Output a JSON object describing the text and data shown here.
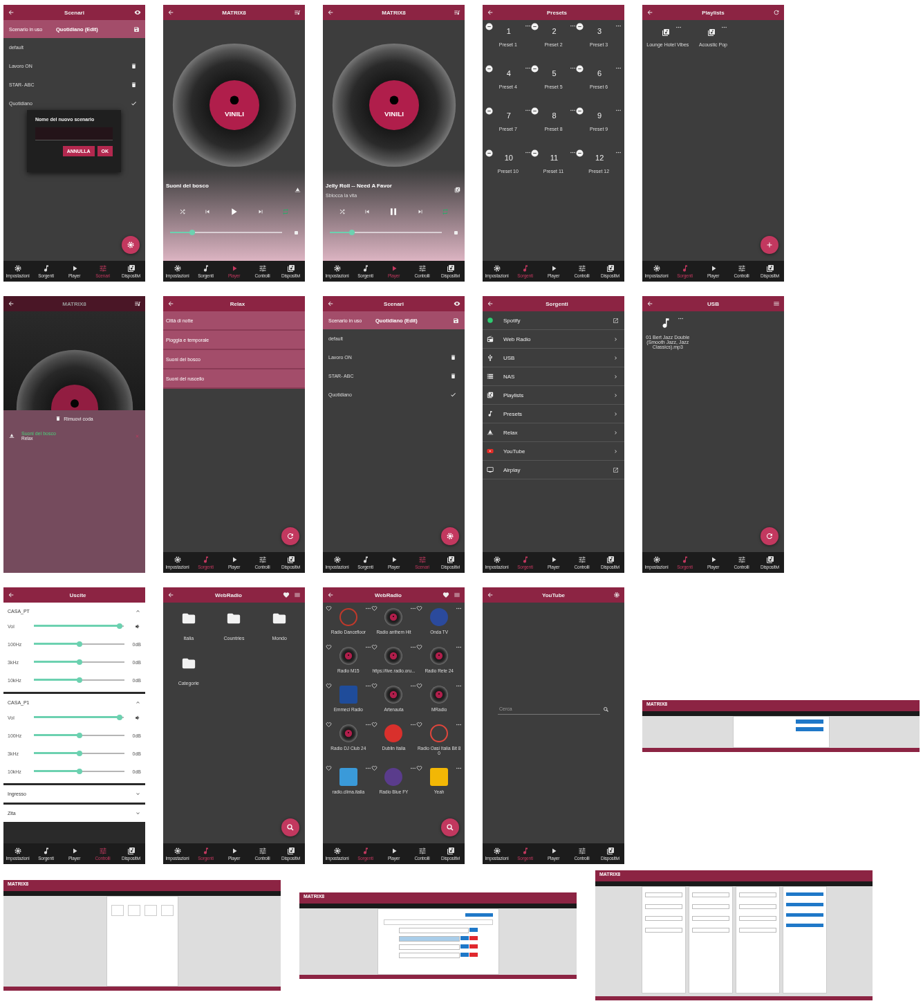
{
  "rows": [
    {
      "screens": [
        {
          "kind": "scenari",
          "title": "Scenari",
          "current": {
            "label": "Scenario in uso",
            "value": "Quotidiano (Edit)"
          },
          "items": [
            {
              "label": "default",
              "selected": false,
              "deletable": false
            },
            {
              "label": "Lavoro ON",
              "selected": false,
              "deletable": true
            },
            {
              "label": "STAR- ABC",
              "selected": false,
              "deletable": true
            },
            {
              "label": "Quotidiano",
              "selected": true,
              "deletable": false
            }
          ],
          "dialog": {
            "title": "Nome del nuovo scenario",
            "buttons": [
              "ANNULLA",
              "OK"
            ]
          },
          "nav": [
            {
              "label": "Impostazioni",
              "selected": false
            },
            {
              "label": "Sorgenti",
              "selected": false
            },
            {
              "label": "Player",
              "selected": false
            },
            {
              "label": "Scenari",
              "selected": true
            },
            {
              "label": "Dispositivi",
              "selected": false
            }
          ]
        },
        {
          "kind": "player",
          "title": "MATRIX8",
          "disc_label": "VINILI",
          "track": "Suoni del bosco",
          "playing": false,
          "level": 0.22,
          "nav": [
            {
              "label": "Impostazioni",
              "selected": false
            },
            {
              "label": "Sorgenti",
              "selected": false
            },
            {
              "label": "Player",
              "selected": true
            },
            {
              "label": "Controlli",
              "selected": false
            },
            {
              "label": "Dispositivi",
              "selected": false
            }
          ]
        },
        {
          "kind": "player",
          "title": "MATRIX8",
          "disc_label": "VINILI",
          "track": "Jelly Roll -- Need A Favor",
          "subtitle": "Sblocca la vita",
          "playing": true,
          "level": 0.22,
          "nav": [
            {
              "label": "Impostazioni",
              "selected": false
            },
            {
              "label": "Sorgenti",
              "selected": false
            },
            {
              "label": "Player",
              "selected": true
            },
            {
              "label": "Controlli",
              "selected": false
            },
            {
              "label": "Dispositivi",
              "selected": false
            }
          ]
        },
        {
          "kind": "presets",
          "title": "Presets",
          "items": [
            {
              "number": "1",
              "label": "Preset 1"
            },
            {
              "number": "2",
              "label": "Preset 2"
            },
            {
              "number": "3",
              "label": "Preset 3"
            },
            {
              "number": "4",
              "label": "Preset 4"
            },
            {
              "number": "5",
              "label": "Preset 5"
            },
            {
              "number": "6",
              "label": "Preset 6"
            },
            {
              "number": "7",
              "label": "Preset 7"
            },
            {
              "number": "8",
              "label": "Preset 8"
            },
            {
              "number": "9",
              "label": "Preset 9"
            },
            {
              "number": "10",
              "label": "Preset 10"
            },
            {
              "number": "11",
              "label": "Preset 11"
            },
            {
              "number": "12",
              "label": "Preset 12"
            }
          ],
          "nav": [
            {
              "label": "Impostazioni",
              "selected": false
            },
            {
              "label": "Sorgenti",
              "selected": true
            },
            {
              "label": "Player",
              "selected": false
            },
            {
              "label": "Controlli",
              "selected": false
            },
            {
              "label": "Dispositivi",
              "selected": false
            }
          ]
        },
        {
          "kind": "playlists",
          "title": "Playlists",
          "items": [
            {
              "label": "Lounge Hotel Vibes"
            },
            {
              "label": "Acoustic Pop"
            }
          ],
          "nav": [
            {
              "label": "Impostazioni",
              "selected": false
            },
            {
              "label": "Sorgenti",
              "selected": true
            },
            {
              "label": "Player",
              "selected": false
            },
            {
              "label": "Controlli",
              "selected": false
            },
            {
              "label": "Dispositivi",
              "selected": false
            }
          ]
        }
      ]
    },
    {
      "screens": [
        {
          "kind": "queue",
          "title": "MATRIX8",
          "clear_label": "Rimuovi coda",
          "items": [
            {
              "title": "Suoni del bosco",
              "subtitle": "Relax"
            }
          ]
        },
        {
          "kind": "list",
          "title": "Relax",
          "items": [
            {
              "label": "Città di notte"
            },
            {
              "label": "Pioggia e temporale"
            },
            {
              "label": "Suoni del bosco"
            },
            {
              "label": "Suoni del ruscello"
            }
          ],
          "nav": [
            {
              "label": "Impostazioni",
              "selected": false
            },
            {
              "label": "Sorgenti",
              "selected": true
            },
            {
              "label": "Player",
              "selected": false
            },
            {
              "label": "Controlli",
              "selected": false
            },
            {
              "label": "Dispositivi",
              "selected": false
            }
          ]
        },
        {
          "kind": "scenari",
          "title": "Scenari",
          "current": {
            "label": "Scenario in uso",
            "value": "Quotidiano (Edit)"
          },
          "items": [
            {
              "label": "default",
              "selected": false,
              "deletable": false
            },
            {
              "label": "Lavoro ON",
              "selected": false,
              "deletable": true
            },
            {
              "label": "STAR- ABC",
              "selected": false,
              "deletable": true
            },
            {
              "label": "Quotidiano",
              "selected": true,
              "deletable": false
            }
          ],
          "nav": [
            {
              "label": "Impostazioni",
              "selected": false
            },
            {
              "label": "Sorgenti",
              "selected": false
            },
            {
              "label": "Player",
              "selected": false
            },
            {
              "label": "Scenari",
              "selected": true
            },
            {
              "label": "Dispositivi",
              "selected": false
            }
          ]
        },
        {
          "kind": "sources",
          "title": "Sorgenti",
          "items": [
            {
              "label": "Spotify"
            },
            {
              "label": "Web Radio"
            },
            {
              "label": "USB"
            },
            {
              "label": "NAS"
            },
            {
              "label": "Playlists"
            },
            {
              "label": "Presets"
            },
            {
              "label": "Relax"
            },
            {
              "label": "YouTube"
            },
            {
              "label": "Airplay"
            }
          ],
          "nav": [
            {
              "label": "Impostazioni",
              "selected": false
            },
            {
              "label": "Sorgenti",
              "selected": true
            },
            {
              "label": "Player",
              "selected": false
            },
            {
              "label": "Controlli",
              "selected": false
            },
            {
              "label": "Dispositivi",
              "selected": false
            }
          ]
        },
        {
          "kind": "usb",
          "title": "USB",
          "items": [
            {
              "label": "01 Bert Jazz Double (Smooth Jazz, Jazz Classics).mp3"
            }
          ],
          "nav": [
            {
              "label": "Impostazioni",
              "selected": false
            },
            {
              "label": "Sorgenti",
              "selected": true
            },
            {
              "label": "Player",
              "selected": false
            },
            {
              "label": "Controlli",
              "selected": false
            },
            {
              "label": "Dispositivi",
              "selected": false
            }
          ]
        }
      ]
    },
    {
      "screens": [
        {
          "kind": "outputs",
          "title": "Uscite",
          "sections": [
            {
              "name": "CASA_PT",
              "expanded": true,
              "channels": [
                {
                  "kind": "volume",
                  "label": "Vol",
                  "level": 0.95
                },
                {
                  "kind": "eq",
                  "label": "100Hz",
                  "level": 0.5,
                  "reading": "0dB"
                },
                {
                  "kind": "eq",
                  "label": "3kHz",
                  "level": 0.5,
                  "reading": "0dB"
                },
                {
                  "kind": "eq",
                  "label": "10kHz",
                  "level": 0.5,
                  "reading": "0dB"
                }
              ]
            },
            {
              "name": "CASA_P1",
              "expanded": true,
              "channels": [
                {
                  "kind": "volume",
                  "label": "Vol",
                  "level": 0.95
                },
                {
                  "kind": "eq",
                  "label": "100Hz",
                  "level": 0.5,
                  "reading": "0dB"
                },
                {
                  "kind": "eq",
                  "label": "3kHz",
                  "level": 0.5,
                  "reading": "0dB"
                },
                {
                  "kind": "eq",
                  "label": "10kHz",
                  "level": 0.5,
                  "reading": "0dB"
                }
              ]
            },
            {
              "name": "Ingresso",
              "expanded": false
            },
            {
              "name": "Zita",
              "expanded": false
            }
          ],
          "nav": [
            {
              "label": "Impostazioni",
              "selected": false
            },
            {
              "label": "Sorgenti",
              "selected": false
            },
            {
              "label": "Player",
              "selected": false
            },
            {
              "label": "Controlli",
              "selected": true
            },
            {
              "label": "Dispositivi",
              "selected": false
            }
          ]
        },
        {
          "kind": "folders",
          "title": "WebRadio",
          "items": [
            {
              "label": "Italia"
            },
            {
              "label": "Countries"
            },
            {
              "label": "Mondo"
            },
            {
              "label": "Categorie"
            }
          ],
          "nav": [
            {
              "label": "Impostazioni",
              "selected": false
            },
            {
              "label": "Sorgenti",
              "selected": true
            },
            {
              "label": "Player",
              "selected": false
            },
            {
              "label": "Controlli",
              "selected": false
            },
            {
              "label": "Dispositivi",
              "selected": false
            }
          ]
        },
        {
          "kind": "stations",
          "title": "WebRadio",
          "items": [
            {
              "label": "Radio Dancefloor",
              "kind": "ring",
              "color": "#c0392b"
            },
            {
              "label": "Radio anthem Hit",
              "kind": "vinyl"
            },
            {
              "label": "Onda TV",
              "kind": "badge",
              "color": "#2b4a9c"
            },
            {
              "label": "Radio M15",
              "kind": "vinyl"
            },
            {
              "label": "https://live.radio.oru...",
              "kind": "vinyl"
            },
            {
              "label": "Radio Rete 24",
              "kind": "vinyl"
            },
            {
              "label": "Emmeci Radio",
              "kind": "square",
              "color": "#1f4c9a"
            },
            {
              "label": "Artenauta",
              "kind": "vinyl"
            },
            {
              "label": "MRadio",
              "kind": "vinyl"
            },
            {
              "label": "Radio DJ Club 24",
              "kind": "vinyl"
            },
            {
              "label": "Dublin Italia",
              "kind": "badge",
              "color": "#d9302c"
            },
            {
              "label": "Radio Oasi Italia Bit 80",
              "kind": "ring",
              "color": "#e0463c"
            },
            {
              "label": "radio.clima.italia",
              "kind": "square",
              "color": "#3a9ad9"
            },
            {
              "label": "Radio Blue FY",
              "kind": "badge",
              "color": "#5a3c8c"
            },
            {
              "label": "Yeah",
              "kind": "square",
              "color": "#f2b705"
            }
          ],
          "nav": [
            {
              "label": "Impostazioni",
              "selected": false
            },
            {
              "label": "Sorgenti",
              "selected": true
            },
            {
              "label": "Player",
              "selected": false
            },
            {
              "label": "Controlli",
              "selected": false
            },
            {
              "label": "Dispositivi",
              "selected": false
            }
          ]
        },
        {
          "kind": "youtube",
          "title": "YouTube",
          "search": {
            "placeholder": "Cerca"
          },
          "nav": [
            {
              "label": "Impostazioni",
              "selected": false
            },
            {
              "label": "Sorgenti",
              "selected": true
            },
            {
              "label": "Player",
              "selected": false
            },
            {
              "label": "Controlli",
              "selected": false
            },
            {
              "label": "Dispositivi",
              "selected": false
            }
          ]
        },
        {
          "kind": "web",
          "title": "MATRIX8",
          "content": {
            "kind": "buttons"
          }
        }
      ]
    },
    {
      "screens": [
        {
          "kind": "web",
          "title": "MATRIX8",
          "content": {
            "kind": "cards"
          }
        },
        {
          "kind": "web",
          "title": "MATRIX8",
          "content": {
            "kind": "list"
          }
        },
        {
          "kind": "web",
          "title": "MATRIX8",
          "content": {
            "kind": "columns"
          }
        }
      ]
    }
  ]
}
